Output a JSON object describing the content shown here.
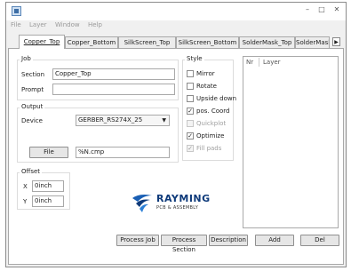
{
  "window": {
    "minimize": "–",
    "maximize": "□",
    "close": "✕"
  },
  "menu": [
    "File",
    "Layer",
    "Window",
    "Help"
  ],
  "tabs": [
    "Copper_Top",
    "Copper_Bottom",
    "SilkScreen_Top",
    "SilkScreen_Bottom",
    "SolderMask_Top",
    "SolderMask_"
  ],
  "tab_scroll": "▶",
  "job": {
    "title": "Job",
    "section_label": "Section",
    "section_value": "Copper_Top",
    "prompt_label": "Prompt",
    "prompt_value": ""
  },
  "output": {
    "title": "Output",
    "device_label": "Device",
    "device_value": "GERBER_RS274X_25",
    "file_button": "File",
    "file_value": "%N.cmp"
  },
  "offset": {
    "title": "Offset",
    "x_label": "X",
    "x_value": "0inch",
    "y_label": "Y",
    "y_value": "0inch"
  },
  "style": {
    "title": "Style",
    "options": [
      {
        "label": "Mirror",
        "checked": false,
        "disabled": false
      },
      {
        "label": "Rotate",
        "checked": false,
        "disabled": false
      },
      {
        "label": "Upside down",
        "checked": false,
        "disabled": false
      },
      {
        "label": "pos. Coord",
        "checked": true,
        "disabled": false
      },
      {
        "label": "Quickplot",
        "checked": false,
        "disabled": true
      },
      {
        "label": "Optimize",
        "checked": true,
        "disabled": false
      },
      {
        "label": "Fill pads",
        "checked": true,
        "disabled": true
      }
    ]
  },
  "layers": {
    "col_nr": "Nr",
    "col_layer": "Layer"
  },
  "logo": {
    "name": "RAYMING",
    "tagline": "PCB & ASSEMBLY"
  },
  "buttons": {
    "process_job": "Process Job",
    "process_section": "Process Section",
    "description": "Description",
    "add": "Add",
    "del": "Del"
  }
}
